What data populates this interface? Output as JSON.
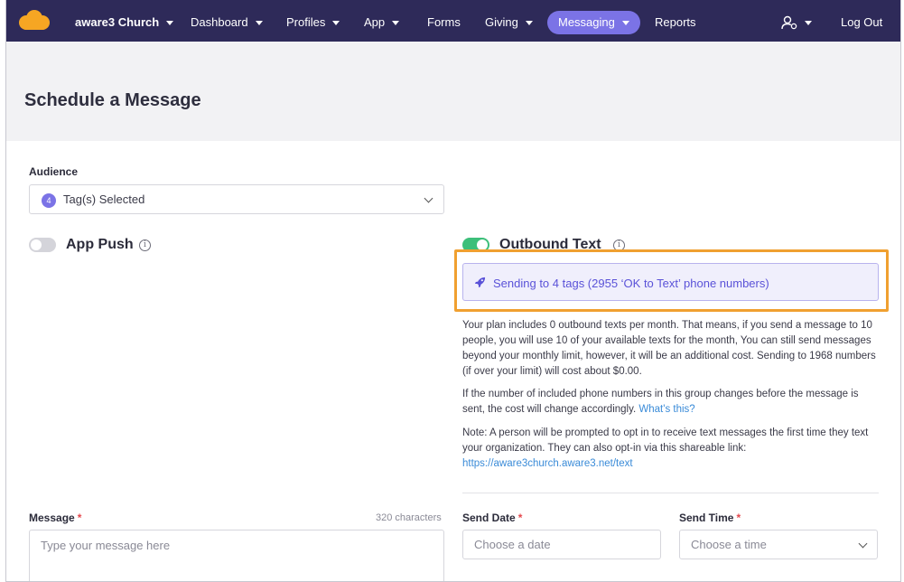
{
  "nav": {
    "org_label": "aware3 Church",
    "items": [
      {
        "label": "Dashboard",
        "has_caret": true
      },
      {
        "label": "Profiles",
        "has_caret": true
      },
      {
        "label": "App",
        "has_caret": true
      },
      {
        "label": "Forms",
        "has_caret": false
      },
      {
        "label": "Giving",
        "has_caret": true
      },
      {
        "label": "Messaging",
        "has_caret": true,
        "active": true
      },
      {
        "label": "Reports",
        "has_caret": false
      }
    ],
    "user_icon": "user-settings-icon",
    "logout_label": "Log Out",
    "colors": {
      "bar": "#2e2a59",
      "active": "#7b73e6",
      "logo": "#f6a623"
    }
  },
  "page": {
    "title": "Schedule a Message"
  },
  "audience": {
    "label": "Audience",
    "count_badge": "4",
    "selected_text": "Tag(s) Selected"
  },
  "app_push": {
    "label": "App Push",
    "enabled": false
  },
  "outbound_text": {
    "label": "Outbound Text",
    "enabled": true,
    "sending_summary": "Sending to 4 tags (2955 ‘OK to Text’ phone numbers)",
    "plan_note": "Your plan includes 0 outbound texts per month. That means, if you send a message to 10 people, you will use 10 of your available texts for the month, You can still send messages beyond your monthly limit, however, it will be an additional cost. Sending to 1968 numbers (if over your limit) will cost about $0.00.",
    "change_note": "If the number of included phone numbers in this group changes before the message is sent, the cost will change accordingly.",
    "whats_this_link": "What's this?",
    "optin_note": "Note: A person will be prompted to opt in to receive text messages the first time they text your organization. They can also opt-in via this shareable link:",
    "optin_link": "https://aware3church.aware3.net/text",
    "colors": {
      "toggle_on": "#3dbf7a",
      "summary_text": "#5a52d8",
      "highlight_border": "#f0a030"
    }
  },
  "message": {
    "label": "Message",
    "required_mark": "*",
    "char_count": "320 characters",
    "placeholder": "Type your message here"
  },
  "send_date": {
    "label": "Send Date",
    "required_mark": "*",
    "placeholder": "Choose a date"
  },
  "send_time": {
    "label": "Send Time",
    "required_mark": "*",
    "placeholder": "Choose a time"
  }
}
